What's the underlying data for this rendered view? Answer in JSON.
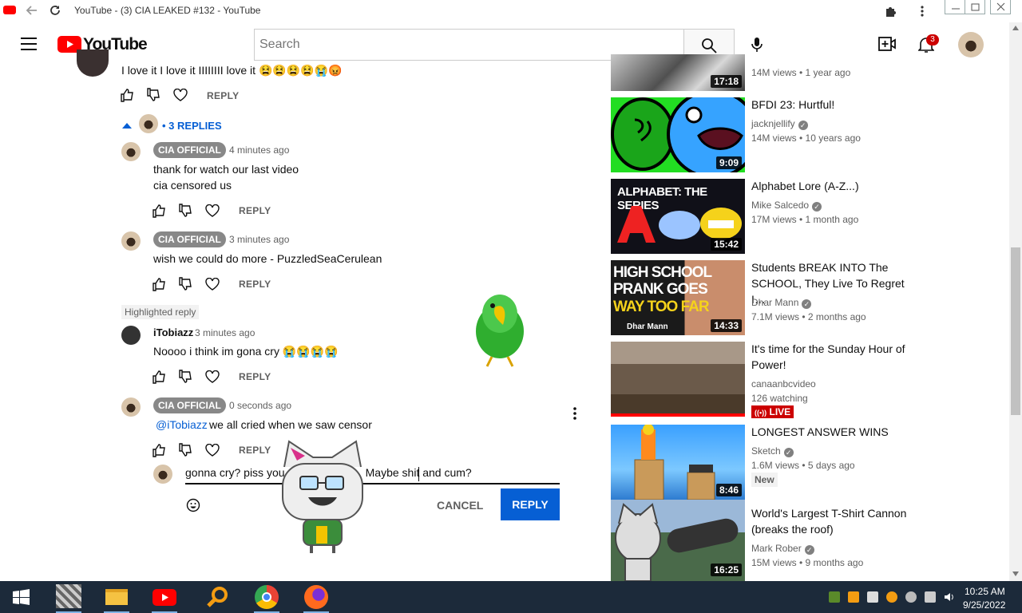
{
  "browser": {
    "tab_title": "YouTube - (3) CIA LEAKED #132 - YouTube"
  },
  "masthead": {
    "logo_text": "YouTube",
    "search_placeholder": "Search",
    "notification_count": "3"
  },
  "comments": {
    "top_comment_text": "I love it I love it IIIIIIII love it 😫😫😫😫😭😡",
    "top_reply_label": "REPLY",
    "replies_toggle": "• 3 REPLIES",
    "replies": [
      {
        "badge": "CIA OFFICIAL",
        "time": "4 minutes ago",
        "line1": "thank for watch our last video",
        "line2": "cia censored us",
        "reply_label": "REPLY"
      },
      {
        "badge": "CIA OFFICIAL",
        "time": "3 minutes ago",
        "line1": "wish we could do more - PuzzledSeaCerulean",
        "reply_label": "REPLY"
      },
      {
        "highlight_label": "Highlighted reply",
        "author": "iTobiazz",
        "time": "3 minutes ago",
        "line1": "Noooo i think im gona cry 😭😭😭😭",
        "reply_label": "REPLY"
      },
      {
        "badge": "CIA OFFICIAL",
        "time": "0 seconds ago",
        "mention": "@iTobiazz",
        "line1": " we all cried when we saw censor",
        "reply_label": "REPLY"
      }
    ],
    "reply_input_value": "gonna cry? piss you                          Maybe shit and cum?",
    "cancel_label": "CANCEL",
    "reply_button_label": "REPLY"
  },
  "sidebar": {
    "videos": [
      {
        "title": "",
        "channel": "",
        "stats": "14M views • 1 year ago",
        "duration": "17:18"
      },
      {
        "title": "BFDI 23: Hurtful!",
        "channel": "jacknjellify",
        "stats": "14M views • 10 years ago",
        "duration": "9:09"
      },
      {
        "title": "Alphabet Lore (A-Z...)",
        "channel": "Mike Salcedo",
        "stats": "17M views • 1 month ago",
        "duration": "15:42",
        "thumb_text": "ALPHABET: THE SERIES"
      },
      {
        "title": "Students BREAK INTO The SCHOOL, They Live To Regret I…",
        "channel": "Dhar Mann",
        "stats": "7.1M views • 2 months ago",
        "duration": "14:33",
        "thumb_text1": "HIGH SCHOOL",
        "thumb_text2": "PRANK GOES",
        "thumb_text3": "WAY TOO FAR",
        "thumb_tag": "Dhar Mann"
      },
      {
        "title": "It's time for the Sunday Hour of Power!",
        "channel": "canaanbcvideo",
        "stats": "126 watching",
        "live": "LIVE"
      },
      {
        "title": "LONGEST ANSWER WINS",
        "channel": "Sketch",
        "stats": "1.6M views • 5 days ago",
        "duration": "8:46",
        "badge": "New"
      },
      {
        "title": "World's Largest T-Shirt Cannon (breaks the roof)",
        "channel": "Mark Rober",
        "stats": "15M views • 9 months ago",
        "duration": "16:25"
      }
    ]
  },
  "taskbar": {
    "time": "10:25 AM",
    "date": "9/25/2022"
  },
  "colors": {
    "youtube_red": "#ff0000",
    "link_blue": "#065fd4",
    "taskbar": "#1c2a3a"
  }
}
